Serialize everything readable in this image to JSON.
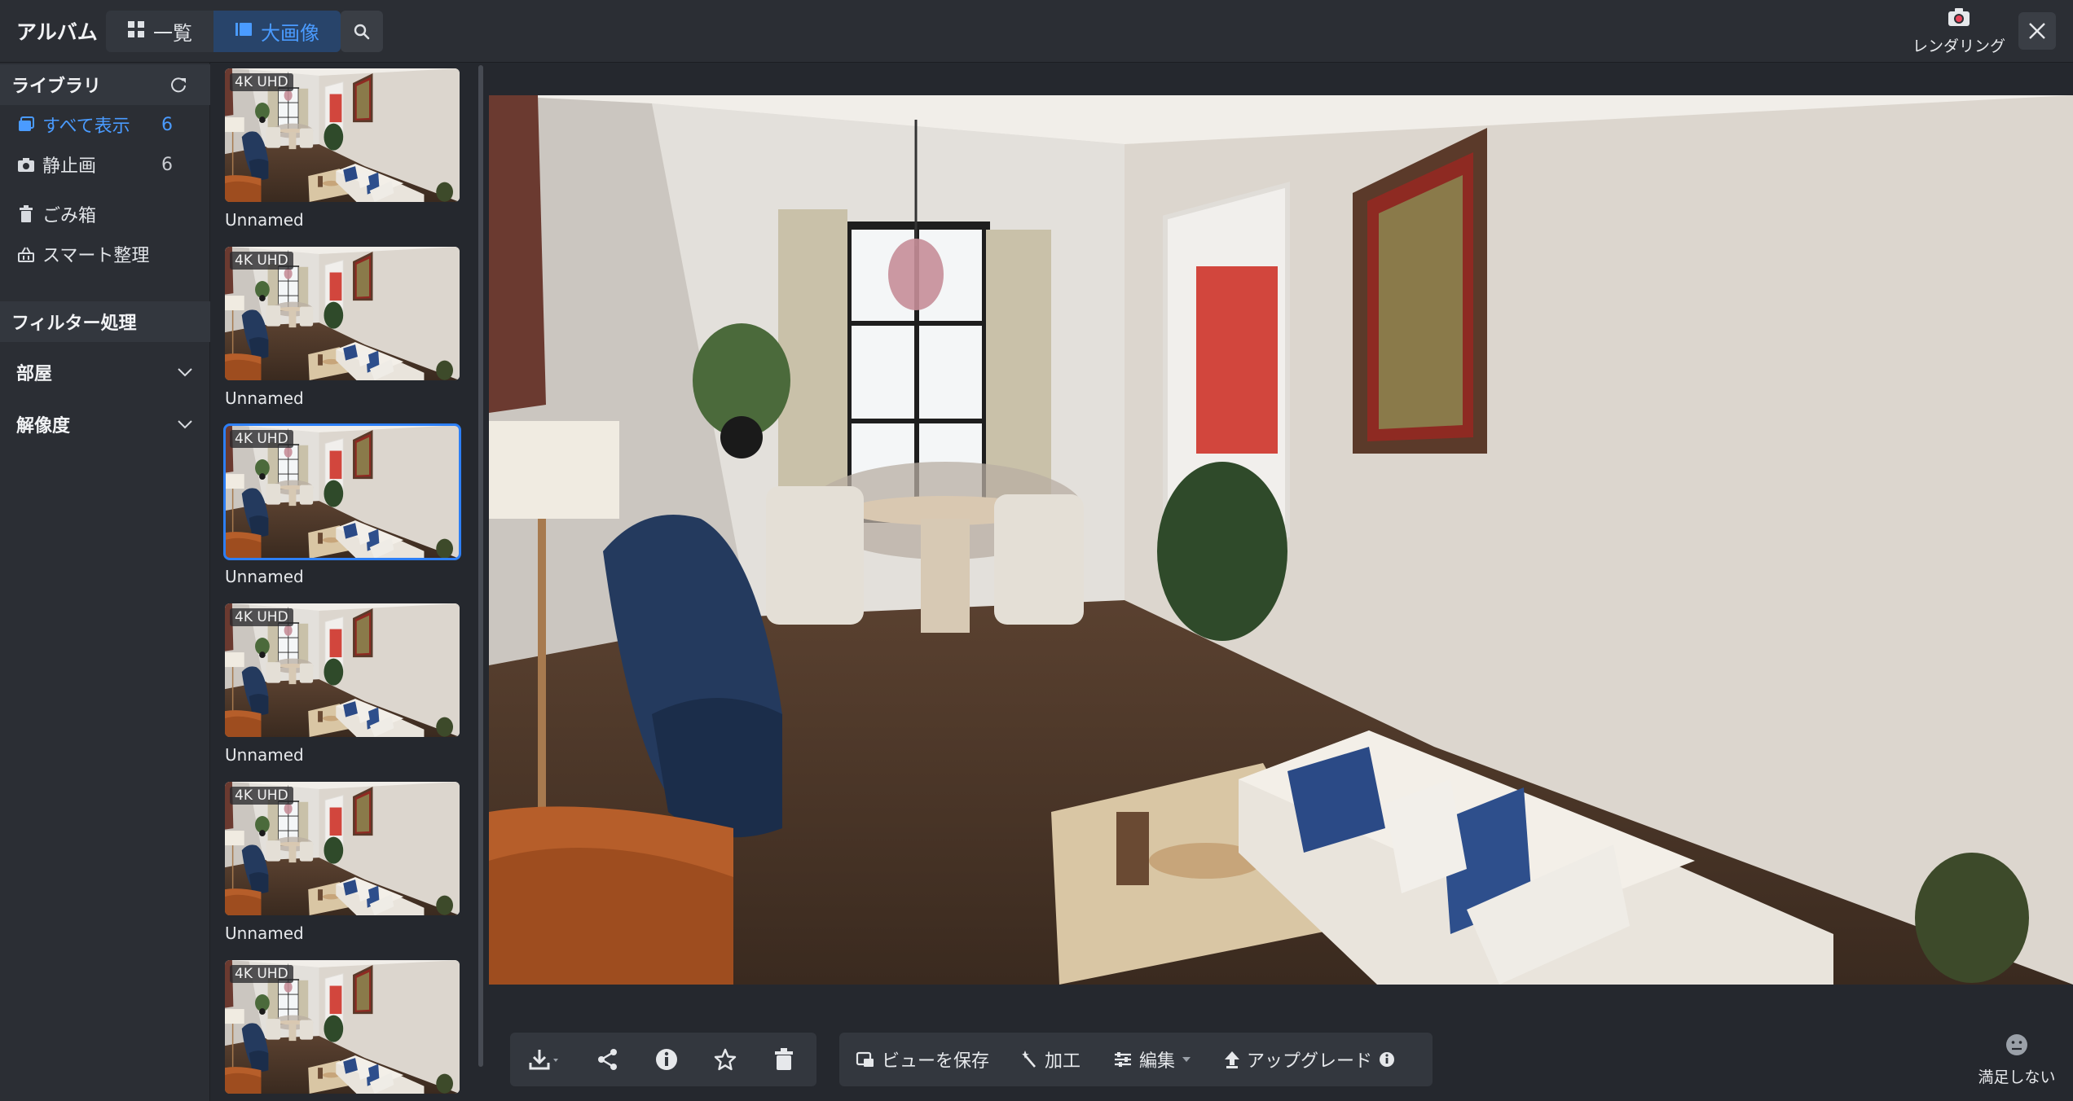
{
  "header": {
    "title": "アルバム",
    "view_tabs": [
      {
        "label": "一覧",
        "icon": "grid-icon",
        "active": false
      },
      {
        "label": "大画像",
        "icon": "large-image-icon",
        "active": true
      }
    ],
    "search_icon": "search-icon",
    "render_label": "レンダリング",
    "close_icon": "close-icon"
  },
  "sidebar": {
    "library_title": "ライブラリ",
    "items": [
      {
        "label": "すべて表示",
        "count": "6",
        "icon": "album-stack-icon",
        "active": true
      },
      {
        "label": "静止画",
        "count": "6",
        "icon": "camera-icon",
        "active": false
      },
      {
        "label": "ごみ箱",
        "icon": "trash-icon"
      },
      {
        "label": "スマート整理",
        "icon": "basket-icon"
      }
    ],
    "filter_title": "フィルター処理",
    "filters": [
      {
        "label": "部屋"
      },
      {
        "label": "解像度"
      }
    ]
  },
  "thumbnails": [
    {
      "badge": "4K UHD",
      "name": "Unnamed",
      "selected": false
    },
    {
      "badge": "4K UHD",
      "name": "Unnamed",
      "selected": false
    },
    {
      "badge": "4K UHD",
      "name": "Unnamed",
      "selected": true
    },
    {
      "badge": "4K UHD",
      "name": "Unnamed",
      "selected": false
    },
    {
      "badge": "4K UHD",
      "name": "Unnamed",
      "selected": false
    },
    {
      "badge": "4K UHD",
      "name": "",
      "selected": false
    }
  ],
  "toolbar": {
    "icons": [
      "download-icon",
      "share-icon",
      "info-icon",
      "star-icon",
      "delete-icon"
    ],
    "save_view_label": "ビューを保存",
    "process_label": "加工",
    "edit_label": "編集",
    "upgrade_label": "アップグレード",
    "dissatisfied_label": "満足しない"
  },
  "colors": {
    "accent": "#4a9bff",
    "selection": "#2d7ff5",
    "panel": "#2b2e34",
    "background": "#25282e"
  }
}
